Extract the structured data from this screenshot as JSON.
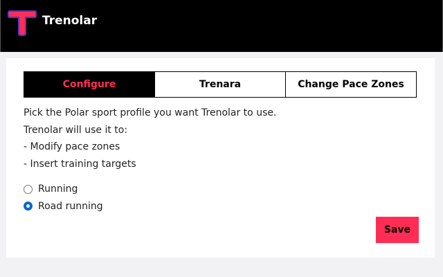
{
  "header": {
    "title": "Trenolar",
    "logo_icon": "trenolar-t-logo"
  },
  "tabs": [
    {
      "label": "Configure",
      "active": true
    },
    {
      "label": "Trenara",
      "active": false
    },
    {
      "label": "Change Pace Zones",
      "active": false
    }
  ],
  "description": {
    "line1": "Pick the Polar sport profile you want Trenolar to use.",
    "line2": "Trenolar will use it to:",
    "line3": "- Modify pace zones",
    "line4": "- Insert training targets"
  },
  "options": [
    {
      "label": "Running",
      "selected": false
    },
    {
      "label": "Road running",
      "selected": true
    }
  ],
  "actions": {
    "save_label": "Save"
  },
  "colors": {
    "accent": "#ff2d55",
    "logo_outline": "#5a35c8",
    "header_bg": "#000000",
    "radio_selected": "#0a66d6"
  }
}
